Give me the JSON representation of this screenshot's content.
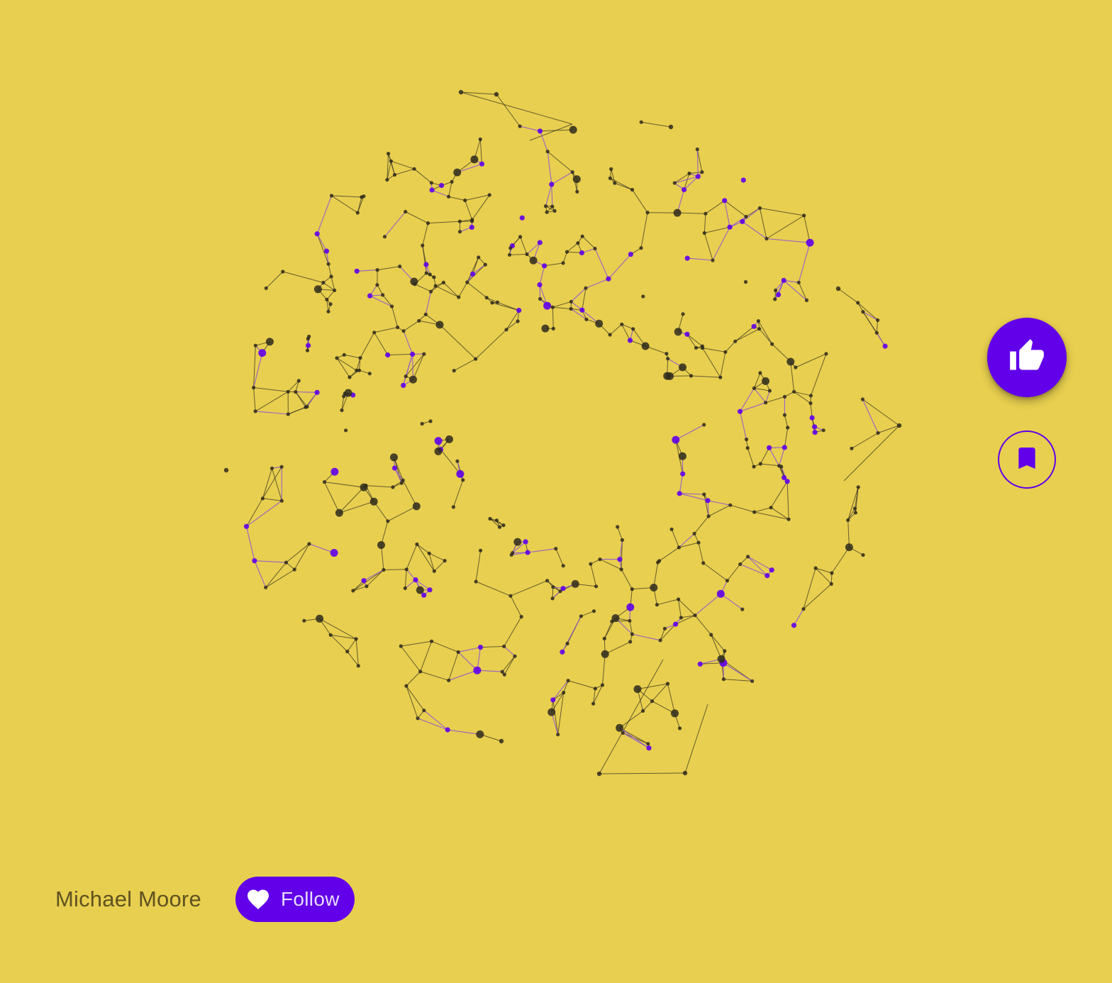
{
  "colors": {
    "background": "#e8cf4f",
    "accent": "#6200ea",
    "node_dark": "#2e2a1c",
    "edge_dark": "#3a3420",
    "node_purple": "#6200ea",
    "edge_purple": "#8a4fd8"
  },
  "artwork": {
    "kind": "network-ring"
  },
  "actions": {
    "like_icon": "thumb-up-icon",
    "bookmark_icon": "bookmark-icon"
  },
  "author": {
    "name": "Michael Moore"
  },
  "follow": {
    "label": "Follow",
    "icon": "heart-icon"
  }
}
